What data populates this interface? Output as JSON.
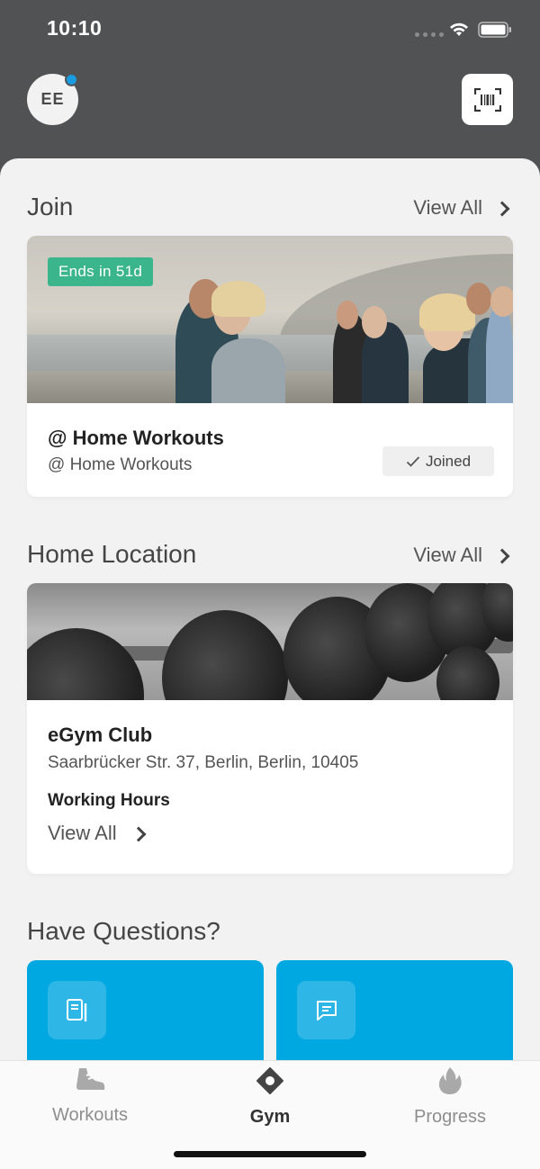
{
  "status_bar": {
    "time": "10:10"
  },
  "header": {
    "avatar_initials": "EE"
  },
  "join": {
    "title": "Join",
    "view_all": "View All",
    "card": {
      "badge": "Ends in 51d",
      "title": "@ Home Workouts",
      "subtitle": "@ Home Workouts",
      "status": "Joined"
    }
  },
  "home_location": {
    "title": "Home Location",
    "view_all": "View All",
    "card": {
      "name": "eGym Club",
      "address": "Saarbrücker Str. 37, Berlin, Berlin, 10405",
      "hours_label": "Working Hours",
      "hours_view_all": "View All"
    }
  },
  "questions": {
    "title": "Have Questions?",
    "cards": [
      {
        "icon": "book-icon"
      },
      {
        "icon": "chat-icon"
      }
    ]
  },
  "tab_bar": {
    "tabs": [
      {
        "label": "Workouts",
        "icon": "shoe-icon",
        "active": false
      },
      {
        "label": "Gym",
        "icon": "location-pin-icon",
        "active": true
      },
      {
        "label": "Progress",
        "icon": "flame-icon",
        "active": false
      }
    ]
  },
  "colors": {
    "header_bg": "#515254",
    "accent_blue": "#00a8e1",
    "badge_green": "#3bb58c",
    "notification_dot": "#1a9be0"
  }
}
